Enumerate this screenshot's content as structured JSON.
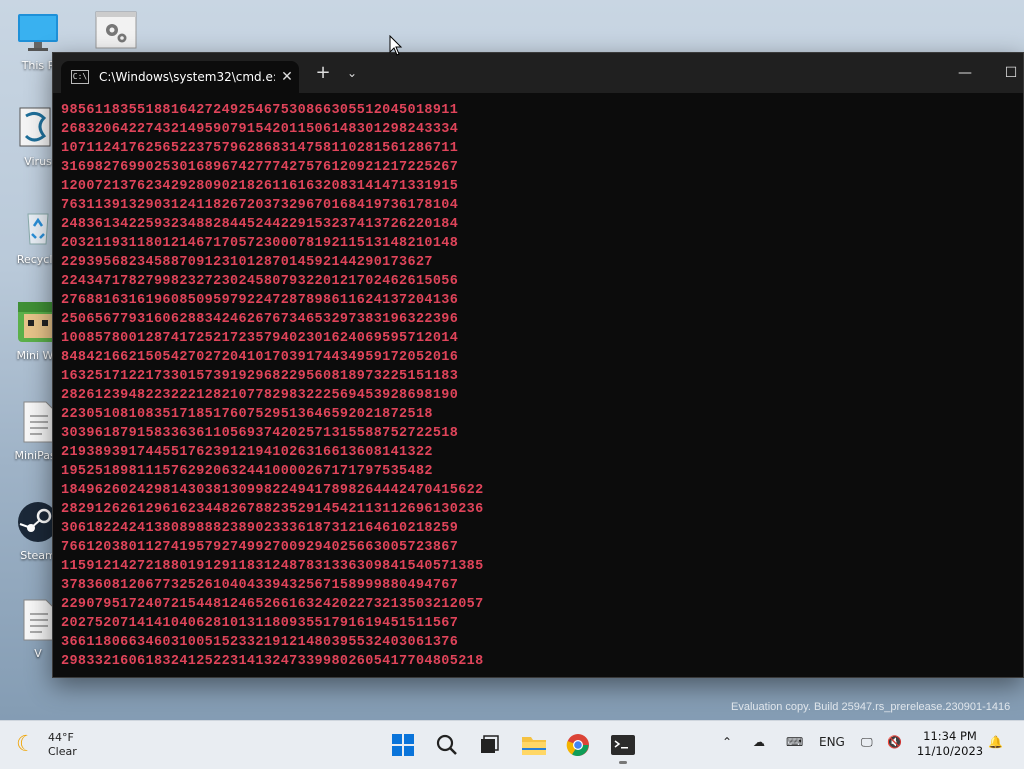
{
  "desktop": {
    "icons": [
      {
        "label": "This P",
        "icon": "computer-icon"
      },
      {
        "label": "",
        "icon": "settings-icon"
      },
      {
        "label": "Virus",
        "icon": "virus-tool-icon"
      },
      {
        "label": "Recycle",
        "icon": "recycle-bin-icon"
      },
      {
        "label": "Mini Wo",
        "icon": "mini-world-icon"
      },
      {
        "label": "MiniPass",
        "icon": "document-icon"
      },
      {
        "label": "Steam",
        "icon": "steam-icon"
      },
      {
        "label": "V",
        "icon": "document-icon"
      }
    ]
  },
  "terminal": {
    "tab_title": "C:\\Windows\\system32\\cmd.e:",
    "tab_icon": "cmd-icon",
    "text_color": "#e0445a",
    "lines": [
      "98561183551881642724925467530866305512045018911",
      "26832064227432149590791542011506148301298243334",
      "10711241762565223757962868314758110281561286711",
      "31698276990253016896742777427576120921217225267",
      "12007213762342928090218261161632083141471331915",
      "76311391329031241182672037329670168419736178104",
      "24836134225932348828445244229153237413726220184",
      "20321193118012146717057230007819211513148210148",
      "22939568234588709123101287014592144290173627",
      "22434717827998232723024580793220121702462615056",
      "27688163161960850959792247287898611624137204136",
      "25065677931606288342462676734653297383196322396",
      "10085780012874172521723579402301624069595712014",
      "84842166215054270272041017039174434959172052016",
      "16325171221733015739192968229560818973225151183",
      "28261239482232221282107782983222569453928698190",
      "22305108108351718517607529513646592021872518",
      "30396187915833636110569374202571315588752722518",
      "21938939174455176239121941026316613608141322",
      "19525189811157629206324410000267171797535482",
      "18496260242981430381309982249417898264442470415622",
      "28291262612961623448267882352914542113112696130236",
      "30618224241380898882389023336187312164610218259",
      "76612038011274195792749927009294025663005723867",
      "11591214272188019129118312487831336309841540571385",
      "37836081206773252610404339432567158999880494767",
      "22907951724072154481246526616324202273213503212057",
      "20275207141410406281013118093551791619451511567",
      "36611806634603100515233219121480395532403061376",
      "29833216061832412522314132473399802605417704805218"
    ]
  },
  "watermark": "Evaluation copy. Build 25947.rs_prerelease.230901-1416",
  "taskbar": {
    "weather": {
      "temp": "44°F",
      "condition": "Clear",
      "icon": "moon-icon"
    },
    "apps": [
      "start-icon",
      "search-icon",
      "task-view-icon",
      "file-explorer-icon",
      "chrome-icon",
      "terminal-icon"
    ],
    "tray": {
      "language": "ENG"
    },
    "clock": {
      "time": "11:34 PM",
      "date": "11/10/2023"
    }
  }
}
